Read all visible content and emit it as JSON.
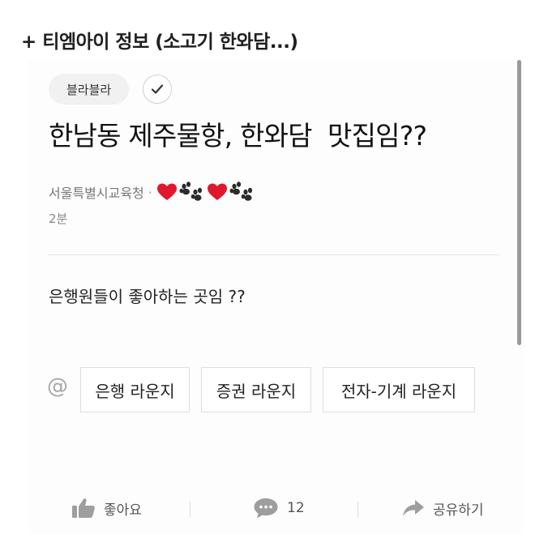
{
  "header": {
    "title": "+ 티엠아이 정보 (소고기 한와담...)"
  },
  "post": {
    "category": "블라블라",
    "title": "한남동 제주물항, 한와담  맛집임??",
    "author": "서울특별시교육청",
    "separator": "·",
    "author_badges": [
      "heart-icon",
      "paw-icon",
      "heart-icon",
      "paw-icon"
    ],
    "read_time": "2분",
    "body": "은행원들이 좋아하는 곳임 ??",
    "mention_symbol": "@",
    "tags": [
      "은행 라운지",
      "증권 라운지",
      "전자-기계 라운지"
    ]
  },
  "actions": {
    "like_label": "좋아요",
    "comment_count": "12",
    "share_label": "공유하기"
  },
  "colors": {
    "heart": "#e0182d",
    "paw": "#2b2b2b",
    "icon_gray": "#9e9e9e"
  }
}
